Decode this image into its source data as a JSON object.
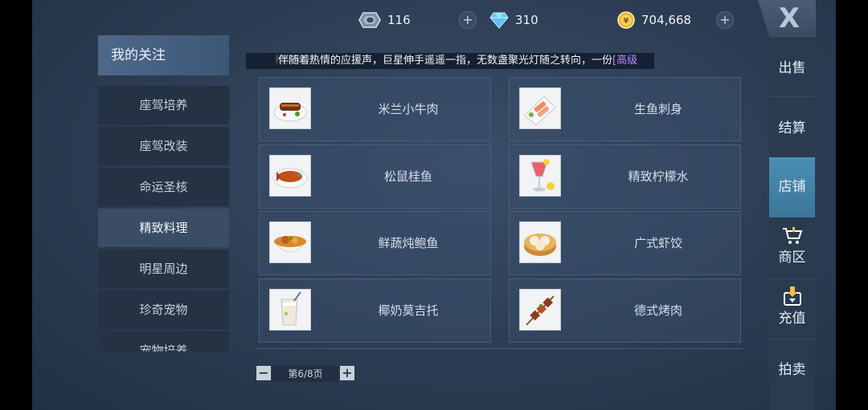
{
  "currencies": [
    {
      "name": "crystal",
      "value": "116",
      "icon": "crystal-icon"
    },
    {
      "name": "diamond",
      "value": "310",
      "icon": "diamond-icon"
    },
    {
      "name": "coin",
      "value": "704,668",
      "icon": "coin-icon"
    }
  ],
  "close_label": "X",
  "sidebar": {
    "title": "我的关注",
    "items": [
      {
        "label": "座驾培养"
      },
      {
        "label": "座驾改装"
      },
      {
        "label": "命运圣核"
      },
      {
        "label": "精致料理"
      },
      {
        "label": "明星周边"
      },
      {
        "label": "珍奇宠物"
      },
      {
        "label": "宠物培养"
      }
    ]
  },
  "marquee": {
    "text": "伴随着热情的应援声，巨星伸手遥遥一指，无数盏聚光灯随之转向，一份",
    "highlight": "[高级",
    "ghost": "精致料理"
  },
  "products": [
    {
      "name": "米兰小牛肉",
      "icon": "grilled-veal-icon"
    },
    {
      "name": "生鱼刺身",
      "icon": "sashimi-icon"
    },
    {
      "name": "松鼠桂鱼",
      "icon": "squirrel-fish-icon"
    },
    {
      "name": "精致柠檬水",
      "icon": "lemonade-icon"
    },
    {
      "name": "鲜蔬炖鲍鱼",
      "icon": "abalone-stew-icon"
    },
    {
      "name": "广式虾饺",
      "icon": "shrimp-dumpling-icon"
    },
    {
      "name": "椰奶莫吉托",
      "icon": "mojito-icon"
    },
    {
      "name": "德式烤肉",
      "icon": "bbq-skewer-icon"
    }
  ],
  "pager": {
    "text": "第6/8页",
    "prev": "−",
    "next": "+"
  },
  "right_nav": [
    {
      "label": "出售"
    },
    {
      "label": "结算"
    },
    {
      "label": "店铺"
    },
    {
      "label": "商区",
      "icon": "cart-icon"
    },
    {
      "label": "充值",
      "icon": "recharge-icon"
    },
    {
      "label": "拍卖"
    }
  ]
}
